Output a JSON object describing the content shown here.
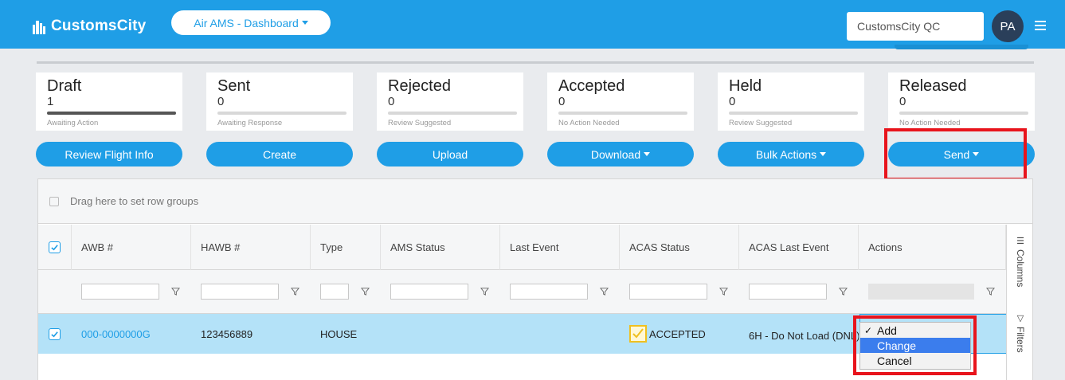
{
  "header": {
    "logo_text": "CustomsCity",
    "dashboard_label": "Air AMS - Dashboard",
    "org_name": "CustomsCity QC",
    "avatar_initials": "PA"
  },
  "status_cards": [
    {
      "title": "Draft",
      "count": "1",
      "subtitle": "Awaiting Action"
    },
    {
      "title": "Sent",
      "count": "0",
      "subtitle": "Awaiting Response"
    },
    {
      "title": "Rejected",
      "count": "0",
      "subtitle": "Review Suggested"
    },
    {
      "title": "Accepted",
      "count": "0",
      "subtitle": "No Action Needed"
    },
    {
      "title": "Held",
      "count": "0",
      "subtitle": "Review Suggested"
    },
    {
      "title": "Released",
      "count": "0",
      "subtitle": "No Action Needed"
    }
  ],
  "actions": {
    "review_flight": "Review Flight Info",
    "create": "Create",
    "upload": "Upload",
    "download": "Download",
    "bulk_actions": "Bulk Actions",
    "send": "Send"
  },
  "grid": {
    "group_placeholder": "Drag here to set row groups",
    "columns": [
      "AWB #",
      "HAWB #",
      "Type",
      "AMS Status",
      "Last Event",
      "ACAS Status",
      "ACAS Last Event",
      "Actions"
    ],
    "rows": [
      {
        "awb": "000-0000000G",
        "hawb": "123456889",
        "type": "HOUSE",
        "ams_status": "",
        "last_event": "",
        "acas_status": "ACCEPTED",
        "acas_last_event": "6H - Do Not Load (DNL)"
      }
    ],
    "side_tabs": {
      "columns": "Columns",
      "filters": "Filters"
    }
  },
  "action_dropdown": {
    "options": [
      "Add",
      "Change",
      "Cancel"
    ],
    "checked": "Add",
    "highlighted": "Change"
  },
  "colors": {
    "brand": "#1f9ee6",
    "highlight_row": "#b4e2f8",
    "annotation": "#e8141c"
  }
}
